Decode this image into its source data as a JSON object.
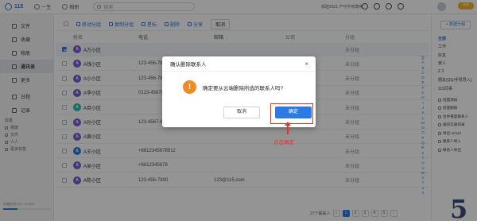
{
  "topbar": {
    "brand": "115",
    "nav": [
      "一生",
      "相册"
    ],
    "search_placeholder": "搜索",
    "tip": "体验2021 产可不肯角等",
    "vip": "VIP"
  },
  "sidebar": {
    "items": [
      "文件",
      "收藏",
      "相册",
      "通讯录",
      "更多",
      "日程",
      "记录"
    ],
    "active": "通讯录",
    "section_label": "标签",
    "small_items": [
      "相册",
      "文件",
      "人人",
      "更多标签"
    ],
    "storage": "存储空间 1T/1.1T/10G"
  },
  "toolbar": {
    "buttons": [
      "移动分组",
      "复制分组",
      "星标",
      "删除",
      "分享"
    ],
    "cancel": "取消"
  },
  "table": {
    "headers": [
      "姓名",
      "电话",
      "邮箱",
      "公司",
      "分组"
    ],
    "rows": [
      {
        "initial": "A",
        "name": "A方小区",
        "phone": "",
        "email": "",
        "company": "",
        "group": "未分组",
        "color": "#7b5cd6",
        "checked": true
      },
      {
        "initial": "A",
        "name": "A钱小区",
        "phone": "123-456-7890",
        "email": "",
        "company": "",
        "group": "未分组",
        "color": "#7b5cd6",
        "checked": false
      },
      {
        "initial": "A",
        "name": "A小小区",
        "phone": "123-456-789-12",
        "email": "",
        "company": "",
        "group": "未分组",
        "color": "#7b5cd6",
        "checked": false
      },
      {
        "initial": "A",
        "name": "A李小区",
        "phone": "0123-45678",
        "email": "",
        "company": "",
        "group": "未分组",
        "color": "#7b5cd6",
        "checked": false
      },
      {
        "initial": "A",
        "name": "A百小区",
        "phone": "",
        "email": "",
        "company": "",
        "group": "未分组",
        "color": "#2fb8b0",
        "checked": false
      },
      {
        "initial": "A",
        "name": "A孙小区",
        "phone": "123-4567-8911",
        "email": "",
        "company": "",
        "group": "未分组",
        "color": "#7b5cd6",
        "checked": false
      },
      {
        "initial": "A",
        "name": "A黄小区",
        "phone": "",
        "email": "",
        "company": "",
        "group": "未分组",
        "color": "#7b5cd6",
        "checked": false
      },
      {
        "initial": "A",
        "name": "A王小区",
        "phone": "+8612345678912",
        "email": "",
        "company": "",
        "group": "未分组",
        "color": "#2c7be5",
        "checked": false
      },
      {
        "initial": "A",
        "name": "A吴小区",
        "phone": "+8612345678",
        "email": "",
        "company": "",
        "group": "未分组",
        "color": "#7b5cd6",
        "checked": false
      },
      {
        "initial": "A",
        "name": "A陈小区",
        "phone": "123-456-7800",
        "email": "123@115.com",
        "company": "",
        "group": "未分组",
        "color": "#7b5cd6",
        "checked": false
      }
    ]
  },
  "right_panel": {
    "new_group": "+ 新建分组",
    "groups": [
      "全部",
      "工作",
      "好友",
      "家人",
      "Z 2",
      "朋友(QQ/手机导入)",
      "115同事"
    ],
    "selected_group": "全部",
    "actions": [
      "批量添加",
      "批量删除",
      "合并重复联系人",
      "通讯云通讯录",
      "导出 vCard",
      "联系人导入",
      "联系人导出"
    ]
  },
  "alphabet": [
    "全",
    "A",
    "B",
    "C",
    "D",
    "E",
    "F",
    "G",
    "H",
    "I",
    "J",
    "K",
    "L",
    "M",
    "N",
    "O",
    "P",
    "Q",
    "R",
    "S",
    "T",
    "U",
    "V",
    "W",
    "X",
    "Y",
    "Z",
    "#"
  ],
  "pagination": {
    "summary": "27个联系人",
    "pages": [
      "1",
      "2",
      "3",
      "4",
      "5"
    ],
    "current": "1"
  },
  "watermark": "5",
  "dialog": {
    "title": "确认删除联系人",
    "close": "×",
    "message": "确定要从云端删除所选的联系人吗?",
    "cancel": "取消",
    "confirm": "确定"
  },
  "annotation": "点击确定",
  "colors": {
    "accent": "#2c7be5",
    "warning": "#f08a24",
    "highlight": "#e8312a"
  }
}
